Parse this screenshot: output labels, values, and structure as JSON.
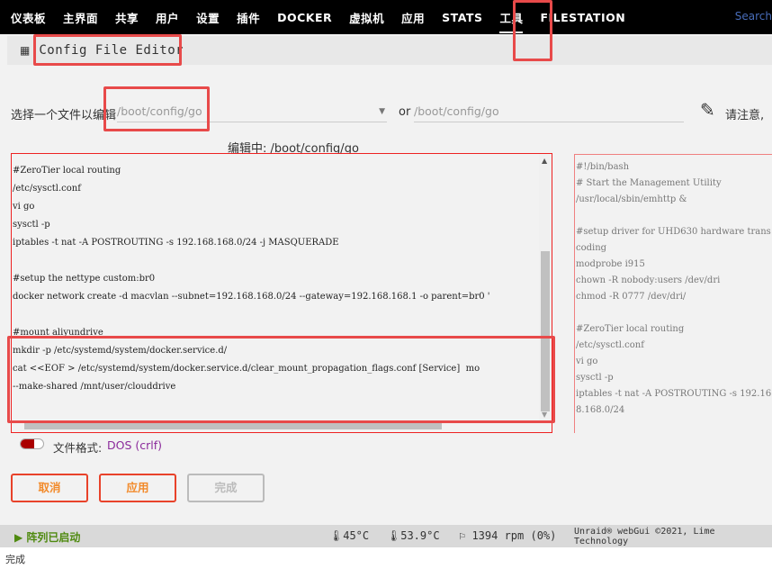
{
  "nav": {
    "items": [
      "仪表板",
      "主界面",
      "共享",
      "用户",
      "设置",
      "插件",
      "DOCKER",
      "虚拟机",
      "应用",
      "STATS",
      "工具",
      "FILESTATION"
    ],
    "active": "工具",
    "search": "Search"
  },
  "header": {
    "icon": "grid-icon",
    "title": "Config File Editor"
  },
  "file_select": {
    "label": "选择一个文件以编辑",
    "value": "/boot/config/go",
    "or": "or",
    "path_placeholder": "/boot/config/go",
    "note": "请注意,"
  },
  "editing": "编辑中: /boot/config/go",
  "editor": {
    "lines": [
      "",
      "#ZeroTier local routing",
      "/etc/sysctl.conf",
      "vi go",
      "sysctl -p",
      "iptables -t nat -A POSTROUTING -s 192.168.168.0/24 -j MASQUERADE",
      "",
      "#setup the nettype custom:br0",
      "docker network create -d macvlan --subnet=192.168.168.0/24 --gateway=192.168.168.1 -o parent=br0 '",
      "",
      "#mount aliyundrive",
      "mkdir -p /etc/systemd/system/docker.service.d/",
      "cat <<EOF > /etc/systemd/system/docker.service.d/clear_mount_propagation_flags.conf [Service]  mo",
      "--make-shared /mnt/user/clouddrive"
    ]
  },
  "preview": {
    "lines": [
      "#!/bin/bash",
      "# Start the Management Utility",
      "/usr/local/sbin/emhttp &",
      "",
      "#setup driver for UHD630 hardware transcoding",
      "modprobe i915",
      "chown -R nobody:users /dev/dri",
      "chmod -R 0777 /dev/dri/",
      "",
      "#ZeroTier local routing",
      "/etc/sysctl.conf",
      "vi go",
      "sysctl -p",
      "iptables -t nat -A POSTROUTING -s 192.168.168.0/24"
    ]
  },
  "format": {
    "label": "文件格式:",
    "value": "DOS (crlf)"
  },
  "buttons": {
    "cancel": "取消",
    "apply": "应用",
    "done": "完成"
  },
  "footer": {
    "array_status": "阵列已启动",
    "temp1": "45°C",
    "temp2": "53.9°C",
    "fan": "1394 rpm (0%)",
    "copyright": "Unraid® webGui ©2021, Lime Technology"
  },
  "statusbar": "完成",
  "colors": {
    "accent": "#f28a2a",
    "annotation": "#e84a4a",
    "array_ok": "#4f8a10"
  }
}
